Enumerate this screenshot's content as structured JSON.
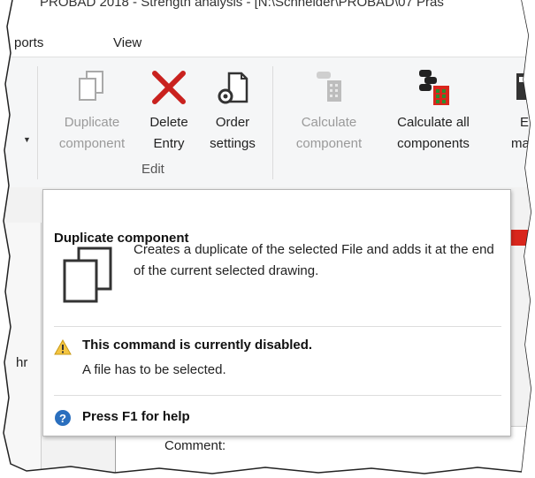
{
  "window": {
    "title": "PROBAD 2018 - Strength analysis - [N:\\Schneider\\PROBAD\\07 Präs"
  },
  "menu": {
    "items": [
      {
        "label": "ports"
      },
      {
        "label": "View"
      }
    ]
  },
  "ribbon": {
    "buttons": [
      {
        "label_line1": "Duplicate",
        "label_line2": "component",
        "icon": "duplicate-icon",
        "disabled": true
      },
      {
        "label_line1": "Delete",
        "label_line2": "Entry",
        "icon": "delete-x-icon",
        "disabled": false
      },
      {
        "label_line1": "Order",
        "label_line2": "settings",
        "icon": "order-settings-icon",
        "disabled": false
      },
      {
        "label_line1": "Calculate",
        "label_line2": "component",
        "icon": "calculate-component-icon",
        "disabled": true
      },
      {
        "label_line1": "Calculate all",
        "label_line2": "components",
        "icon": "calculate-all-icon",
        "disabled": false
      },
      {
        "label_line1": "E",
        "label_line2": "mate",
        "icon": "material-icon",
        "disabled": false
      }
    ],
    "group_edit_label": "Edit"
  },
  "tooltip": {
    "title": "Duplicate component",
    "description": "Creates a duplicate of the selected File and adds it at the end of the current selected drawing.",
    "warning_title": "This command is currently disabled.",
    "warning_sub": "A file has to be selected.",
    "help": "Press F1 for help"
  },
  "background": {
    "left_label": "hr",
    "comment_label": "Comment:"
  },
  "colors": {
    "delete_red": "#c9211e",
    "help_blue": "#2a6fbe",
    "warning_yellow": "#f4c542",
    "accent_red": "#d9261c"
  }
}
